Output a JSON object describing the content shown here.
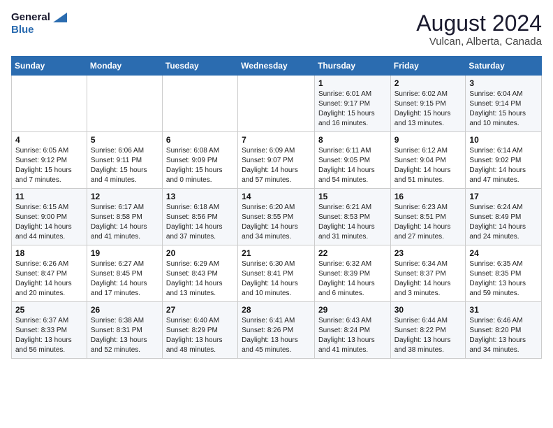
{
  "header": {
    "logo_line1": "General",
    "logo_line2": "Blue",
    "month_year": "August 2024",
    "location": "Vulcan, Alberta, Canada"
  },
  "weekdays": [
    "Sunday",
    "Monday",
    "Tuesday",
    "Wednesday",
    "Thursday",
    "Friday",
    "Saturday"
  ],
  "weeks": [
    [
      {
        "day": "",
        "info": ""
      },
      {
        "day": "",
        "info": ""
      },
      {
        "day": "",
        "info": ""
      },
      {
        "day": "",
        "info": ""
      },
      {
        "day": "1",
        "info": "Sunrise: 6:01 AM\nSunset: 9:17 PM\nDaylight: 15 hours\nand 16 minutes."
      },
      {
        "day": "2",
        "info": "Sunrise: 6:02 AM\nSunset: 9:15 PM\nDaylight: 15 hours\nand 13 minutes."
      },
      {
        "day": "3",
        "info": "Sunrise: 6:04 AM\nSunset: 9:14 PM\nDaylight: 15 hours\nand 10 minutes."
      }
    ],
    [
      {
        "day": "4",
        "info": "Sunrise: 6:05 AM\nSunset: 9:12 PM\nDaylight: 15 hours\nand 7 minutes."
      },
      {
        "day": "5",
        "info": "Sunrise: 6:06 AM\nSunset: 9:11 PM\nDaylight: 15 hours\nand 4 minutes."
      },
      {
        "day": "6",
        "info": "Sunrise: 6:08 AM\nSunset: 9:09 PM\nDaylight: 15 hours\nand 0 minutes."
      },
      {
        "day": "7",
        "info": "Sunrise: 6:09 AM\nSunset: 9:07 PM\nDaylight: 14 hours\nand 57 minutes."
      },
      {
        "day": "8",
        "info": "Sunrise: 6:11 AM\nSunset: 9:05 PM\nDaylight: 14 hours\nand 54 minutes."
      },
      {
        "day": "9",
        "info": "Sunrise: 6:12 AM\nSunset: 9:04 PM\nDaylight: 14 hours\nand 51 minutes."
      },
      {
        "day": "10",
        "info": "Sunrise: 6:14 AM\nSunset: 9:02 PM\nDaylight: 14 hours\nand 47 minutes."
      }
    ],
    [
      {
        "day": "11",
        "info": "Sunrise: 6:15 AM\nSunset: 9:00 PM\nDaylight: 14 hours\nand 44 minutes."
      },
      {
        "day": "12",
        "info": "Sunrise: 6:17 AM\nSunset: 8:58 PM\nDaylight: 14 hours\nand 41 minutes."
      },
      {
        "day": "13",
        "info": "Sunrise: 6:18 AM\nSunset: 8:56 PM\nDaylight: 14 hours\nand 37 minutes."
      },
      {
        "day": "14",
        "info": "Sunrise: 6:20 AM\nSunset: 8:55 PM\nDaylight: 14 hours\nand 34 minutes."
      },
      {
        "day": "15",
        "info": "Sunrise: 6:21 AM\nSunset: 8:53 PM\nDaylight: 14 hours\nand 31 minutes."
      },
      {
        "day": "16",
        "info": "Sunrise: 6:23 AM\nSunset: 8:51 PM\nDaylight: 14 hours\nand 27 minutes."
      },
      {
        "day": "17",
        "info": "Sunrise: 6:24 AM\nSunset: 8:49 PM\nDaylight: 14 hours\nand 24 minutes."
      }
    ],
    [
      {
        "day": "18",
        "info": "Sunrise: 6:26 AM\nSunset: 8:47 PM\nDaylight: 14 hours\nand 20 minutes."
      },
      {
        "day": "19",
        "info": "Sunrise: 6:27 AM\nSunset: 8:45 PM\nDaylight: 14 hours\nand 17 minutes."
      },
      {
        "day": "20",
        "info": "Sunrise: 6:29 AM\nSunset: 8:43 PM\nDaylight: 14 hours\nand 13 minutes."
      },
      {
        "day": "21",
        "info": "Sunrise: 6:30 AM\nSunset: 8:41 PM\nDaylight: 14 hours\nand 10 minutes."
      },
      {
        "day": "22",
        "info": "Sunrise: 6:32 AM\nSunset: 8:39 PM\nDaylight: 14 hours\nand 6 minutes."
      },
      {
        "day": "23",
        "info": "Sunrise: 6:34 AM\nSunset: 8:37 PM\nDaylight: 14 hours\nand 3 minutes."
      },
      {
        "day": "24",
        "info": "Sunrise: 6:35 AM\nSunset: 8:35 PM\nDaylight: 13 hours\nand 59 minutes."
      }
    ],
    [
      {
        "day": "25",
        "info": "Sunrise: 6:37 AM\nSunset: 8:33 PM\nDaylight: 13 hours\nand 56 minutes."
      },
      {
        "day": "26",
        "info": "Sunrise: 6:38 AM\nSunset: 8:31 PM\nDaylight: 13 hours\nand 52 minutes."
      },
      {
        "day": "27",
        "info": "Sunrise: 6:40 AM\nSunset: 8:29 PM\nDaylight: 13 hours\nand 48 minutes."
      },
      {
        "day": "28",
        "info": "Sunrise: 6:41 AM\nSunset: 8:26 PM\nDaylight: 13 hours\nand 45 minutes."
      },
      {
        "day": "29",
        "info": "Sunrise: 6:43 AM\nSunset: 8:24 PM\nDaylight: 13 hours\nand 41 minutes."
      },
      {
        "day": "30",
        "info": "Sunrise: 6:44 AM\nSunset: 8:22 PM\nDaylight: 13 hours\nand 38 minutes."
      },
      {
        "day": "31",
        "info": "Sunrise: 6:46 AM\nSunset: 8:20 PM\nDaylight: 13 hours\nand 34 minutes."
      }
    ]
  ]
}
